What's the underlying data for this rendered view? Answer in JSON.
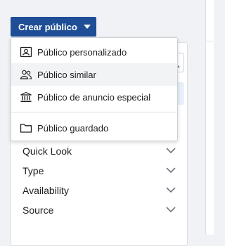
{
  "toolbar": {
    "create_label": "Crear público"
  },
  "dropdown": {
    "items": [
      {
        "label": "Público personalizado",
        "icon": "custom-audience-icon"
      },
      {
        "label": "Público similar",
        "icon": "lookalike-audience-icon"
      },
      {
        "label": "Público de anuncio especial",
        "icon": "special-ad-audience-icon"
      },
      {
        "label": "Público guardado",
        "icon": "folder-icon"
      }
    ]
  },
  "filters": {
    "items": [
      {
        "label": "Quick Look"
      },
      {
        "label": "Type"
      },
      {
        "label": "Availability"
      },
      {
        "label": "Source"
      }
    ]
  },
  "colors": {
    "button": "#1f4e96",
    "hover": "#f2f3f5",
    "highlight": "#e7f0fb"
  }
}
